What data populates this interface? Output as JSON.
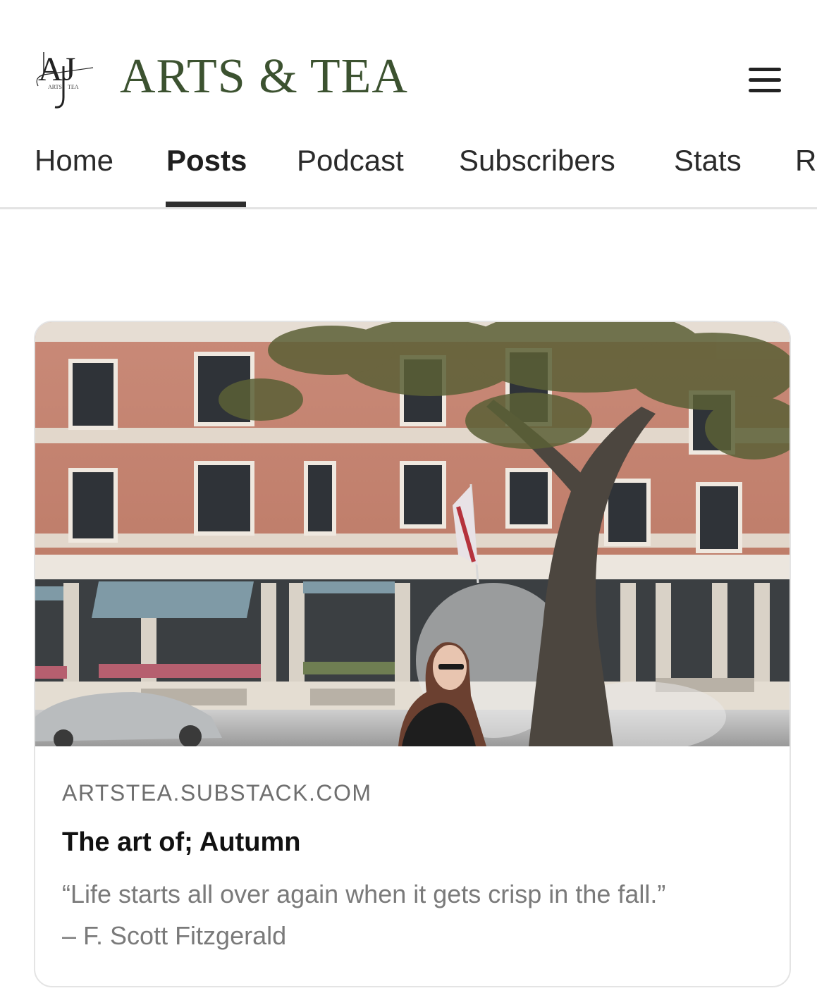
{
  "header": {
    "brand_name": "ARTS & TEA",
    "logo_letters": "AJ",
    "logo_caption_left": "ARTS",
    "logo_caption_right": "TEA",
    "menu_icon": "hamburger-menu-icon"
  },
  "tabs": [
    {
      "label": "Home",
      "active": false
    },
    {
      "label": "Posts",
      "active": true
    },
    {
      "label": "Podcast",
      "active": false
    },
    {
      "label": "Subscribers",
      "active": false
    },
    {
      "label": "Stats",
      "active": false
    },
    {
      "label": "Re",
      "active": false
    }
  ],
  "post": {
    "domain": "ARTSTEA.SUBSTACK.COM",
    "title": "The art of; Autumn",
    "quote": "“Life starts all over again when it gets crisp in the fall.”",
    "attribution": "– F. Scott Fitzgerald"
  },
  "colors": {
    "brand_green": "#3c5230",
    "tab_indicator": "#2e2e2e",
    "muted_text": "#7a7a7a"
  }
}
